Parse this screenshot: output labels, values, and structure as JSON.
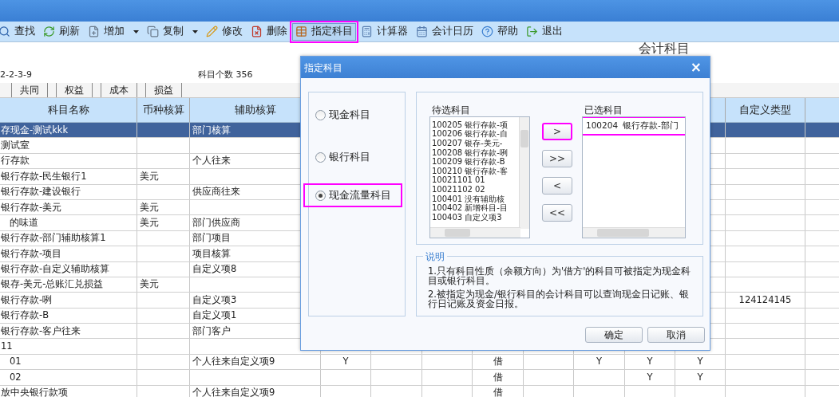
{
  "toolbar": [
    {
      "label": "查找",
      "dropdown": false,
      "active": false,
      "highlighted": false
    },
    {
      "label": "刷新",
      "dropdown": false,
      "active": false,
      "highlighted": false
    },
    {
      "label": "增加",
      "dropdown": true,
      "active": false,
      "highlighted": false
    },
    {
      "label": "复制",
      "dropdown": true,
      "active": false,
      "highlighted": false
    },
    {
      "label": "修改",
      "dropdown": false,
      "active": false,
      "highlighted": false
    },
    {
      "label": "删除",
      "dropdown": false,
      "active": false,
      "highlighted": false
    },
    {
      "label": "指定科目",
      "dropdown": false,
      "active": true,
      "highlighted": true
    },
    {
      "label": "计算器",
      "dropdown": false,
      "active": false,
      "highlighted": false
    },
    {
      "label": "会计日历",
      "dropdown": false,
      "active": false,
      "highlighted": false
    },
    {
      "label": "帮助",
      "dropdown": false,
      "active": false,
      "highlighted": false
    },
    {
      "label": "退出",
      "dropdown": false,
      "active": false,
      "highlighted": false
    }
  ],
  "page_title": "会计科目",
  "date": "2-2-3-9",
  "count_label": "科目个数 356",
  "tabs": [
    "共同",
    "权益",
    "成本",
    "损益"
  ],
  "table": {
    "columns": [
      "科目名称",
      "币种核算",
      "辅助核算",
      null,
      null,
      null,
      null,
      null,
      null,
      null,
      null,
      "自定义类型"
    ],
    "rows": [
      {
        "selected": true,
        "cells": [
          "存现金-测试kkk",
          null,
          "部门核算",
          null,
          null,
          null,
          null,
          null,
          null,
          null,
          null,
          null
        ]
      },
      {
        "selected": false,
        "cells": [
          "测试室",
          null,
          null,
          null,
          null,
          null,
          null,
          null,
          null,
          null,
          null,
          null
        ]
      },
      {
        "selected": false,
        "cells": [
          "行存款",
          null,
          "个人往来",
          null,
          null,
          null,
          null,
          null,
          null,
          null,
          null,
          null
        ]
      },
      {
        "selected": false,
        "cells": [
          "银行存款-民生银行1",
          "美元",
          null,
          null,
          null,
          null,
          null,
          null,
          null,
          null,
          null,
          null
        ]
      },
      {
        "selected": false,
        "cells": [
          "银行存款-建设银行",
          null,
          "供应商往来",
          null,
          null,
          null,
          null,
          null,
          null,
          null,
          null,
          null
        ]
      },
      {
        "selected": false,
        "cells": [
          "银行存款-美元",
          "美元",
          null,
          null,
          null,
          null,
          null,
          null,
          null,
          null,
          null,
          null
        ],
        "children": [
          {
            "selected": false,
            "cells": [
              "的味道",
              "美元",
              "部门供应商",
              null,
              null,
              null,
              null,
              null,
              null,
              null,
              null,
              null
            ]
          }
        ]
      },
      {
        "selected": false,
        "cells": [
          "银行存款-部门辅助核算1",
          null,
          "部门项目",
          null,
          null,
          null,
          null,
          null,
          null,
          null,
          null,
          null
        ]
      },
      {
        "selected": false,
        "cells": [
          "银行存款-项目",
          null,
          "项目核算",
          null,
          null,
          null,
          null,
          null,
          null,
          null,
          null,
          null
        ]
      },
      {
        "selected": false,
        "cells": [
          "银行存款-自定义辅助核算",
          null,
          "自定义项8",
          null,
          null,
          null,
          null,
          null,
          null,
          null,
          null,
          null
        ]
      },
      {
        "selected": false,
        "cells": [
          "银存-美元-总账汇兑损益",
          "美元",
          null,
          null,
          null,
          null,
          null,
          null,
          null,
          null,
          null,
          null
        ]
      },
      {
        "selected": false,
        "cells": [
          "银行存款-咧",
          null,
          "自定义项3",
          null,
          null,
          null,
          null,
          null,
          null,
          null,
          null,
          "124124145"
        ]
      },
      {
        "selected": false,
        "cells": [
          "银行存款-B",
          null,
          "自定义项1",
          null,
          null,
          null,
          null,
          null,
          null,
          null,
          null,
          null
        ]
      },
      {
        "selected": false,
        "cells": [
          "银行存款-客户往来",
          null,
          "部门客户",
          null,
          null,
          null,
          null,
          null,
          null,
          null,
          null,
          null
        ]
      },
      {
        "selected": false,
        "cells": [
          "11",
          null,
          null,
          null,
          null,
          null,
          null,
          null,
          null,
          null,
          null,
          null
        ],
        "children": [
          {
            "selected": false,
            "cells": [
              "01",
              null,
              "个人往来自定义项9",
              "Y",
              null,
              null,
              "借",
              null,
              "Y",
              "Y",
              "Y",
              null
            ]
          },
          {
            "selected": false,
            "cells": [
              "02",
              null,
              null,
              null,
              null,
              null,
              "借",
              null,
              null,
              "Y",
              "Y",
              null
            ]
          }
        ]
      },
      {
        "selected": false,
        "cells": [
          "放中央银行款项",
          null,
          "个人往来自定义项9",
          null,
          null,
          null,
          "借",
          null,
          null,
          null,
          null,
          null
        ]
      }
    ]
  },
  "dialog": {
    "title": "指定科目",
    "close": "×",
    "radios": [
      {
        "label": "现金科目",
        "selected": false,
        "highlighted": false
      },
      {
        "label": "银行科目",
        "selected": false,
        "highlighted": false
      },
      {
        "label": "现金流量科目",
        "selected": true,
        "highlighted": true
      }
    ],
    "candidates": {
      "label": "待选科目",
      "items": [
        {
          "code": "100205",
          "name": "银行存款-项"
        },
        {
          "code": "100206",
          "name": "银行存款-自"
        },
        {
          "code": "100207",
          "name": "银存-美元-"
        },
        {
          "code": "100208",
          "name": "银行存款-咧"
        },
        {
          "code": "100209",
          "name": "银行存款-B"
        },
        {
          "code": "100210",
          "name": "银行存款-客"
        },
        {
          "code": "10021101",
          "name": "01"
        },
        {
          "code": "10021102",
          "name": "02"
        },
        {
          "code": "100401",
          "name": "没有辅助核"
        },
        {
          "code": "100402",
          "name": "新增科目-目"
        },
        {
          "code": "100403",
          "name": "自定义项3"
        }
      ]
    },
    "transfer_buttons": [
      {
        "label": ">",
        "highlighted": true
      },
      {
        "label": ">>",
        "highlighted": false
      },
      {
        "label": "<",
        "highlighted": false
      },
      {
        "label": "<<",
        "highlighted": false
      }
    ],
    "chosen": {
      "label": "已选科目",
      "items": [
        {
          "code": "100204",
          "name": "银行存款-部门",
          "highlighted": true
        }
      ]
    },
    "notes": {
      "title": "说明",
      "paragraphs": [
        "1.只有科目性质（余额方向）为'借方'的科目可被指定为现金科目或银行科目。",
        "2.被指定为现金/银行科目的会计科目可以查询现金日记账、银行日记账及资金日报。"
      ]
    },
    "buttons": [
      "确定",
      "取消"
    ]
  }
}
